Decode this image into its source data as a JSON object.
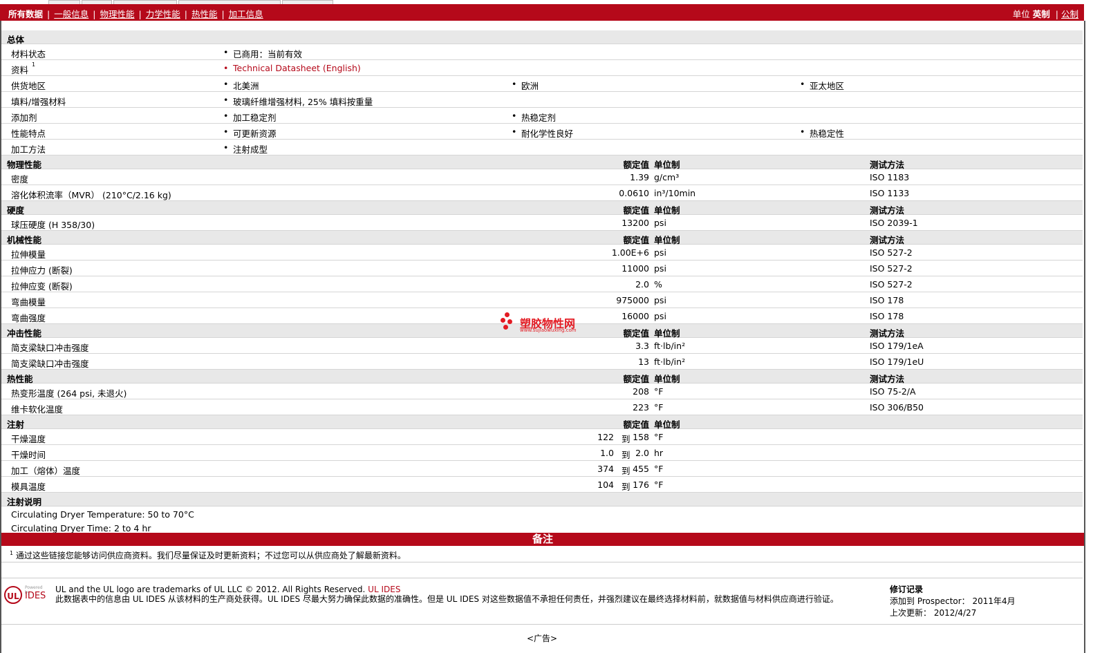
{
  "nav": {
    "all": "所有数据",
    "tabs": [
      "一般信息",
      "物理性能",
      "力学性能",
      "热性能",
      "加工信息"
    ],
    "sep": "|",
    "units_label": "单位",
    "units_current": "英制",
    "units_other": "公制"
  },
  "general": {
    "title": "总体",
    "rows": [
      {
        "label": "材料状态",
        "values": [
          "已商用：当前有效"
        ]
      },
      {
        "label": "资料",
        "sup": "1",
        "values": [
          "Technical Datasheet (English)"
        ]
      },
      {
        "label": "供货地区",
        "values": [
          "北美洲",
          "欧洲",
          "亚太地区"
        ]
      },
      {
        "label": "填料/增强材料",
        "values": [
          "玻璃纤维增强材料, 25% 填料按重量"
        ]
      },
      {
        "label": "添加剂",
        "values": [
          "加工稳定剂",
          "热稳定剂"
        ]
      },
      {
        "label": "性能特点",
        "values": [
          "可更新资源",
          "耐化学性良好",
          "热稳定性"
        ]
      },
      {
        "label": "加工方法",
        "values": [
          "注射成型"
        ]
      }
    ]
  },
  "col_headers": {
    "nominal": "额定值",
    "unit": "单位制",
    "method": "测试方法"
  },
  "sections": [
    {
      "title": "物理性能",
      "rows": [
        {
          "label": "密度",
          "value": "1.39",
          "unit": "g/cm³",
          "method": "ISO 1183"
        },
        {
          "label": "溶化体积流率（MVR） (210°C/2.16 kg)",
          "value": "0.0610",
          "unit": "in³/10min",
          "method": "ISO 1133"
        }
      ]
    },
    {
      "title": "硬度",
      "rows": [
        {
          "label": "球压硬度 (H 358/30)",
          "value": "13200",
          "unit": "psi",
          "method": "ISO 2039-1"
        }
      ]
    },
    {
      "title": "机械性能",
      "rows": [
        {
          "label": "拉伸模量",
          "value": "1.00E+6",
          "unit": "psi",
          "method": "ISO 527-2"
        },
        {
          "label": "拉伸应力 (断裂)",
          "value": "11000",
          "unit": "psi",
          "method": "ISO 527-2"
        },
        {
          "label": "拉伸应变 (断裂)",
          "value": "2.0",
          "unit": "%",
          "method": "ISO 527-2"
        },
        {
          "label": "弯曲模量",
          "value": "975000",
          "unit": "psi",
          "method": "ISO 178"
        },
        {
          "label": "弯曲强度",
          "value": "16000",
          "unit": "psi",
          "method": "ISO 178"
        }
      ]
    },
    {
      "title": "冲击性能",
      "rows": [
        {
          "label": "简支梁缺口冲击强度",
          "value": "3.3",
          "unit": "ft·lb/in²",
          "method": "ISO 179/1eA"
        },
        {
          "label": "简支梁缺口冲击强度",
          "value": "13",
          "unit": "ft·lb/in²",
          "method": "ISO 179/1eU"
        }
      ]
    },
    {
      "title": "热性能",
      "rows": [
        {
          "label": "热变形温度 (264 psi, 未退火)",
          "value": "208",
          "unit": "°F",
          "method": "ISO 75-2/A"
        },
        {
          "label": "维卡软化温度",
          "value": "223",
          "unit": "°F",
          "method": "ISO 306/B50"
        }
      ]
    }
  ],
  "injection": {
    "title": "注射",
    "to": "到",
    "rows": [
      {
        "label": "干燥温度",
        "lo": "122",
        "hi": "158",
        "unit": "°F"
      },
      {
        "label": "干燥时间",
        "lo": "1.0",
        "hi": "2.0",
        "unit": "hr"
      },
      {
        "label": "加工（熔体）温度",
        "lo": "374",
        "hi": "455",
        "unit": "°F"
      },
      {
        "label": "模具温度",
        "lo": "104",
        "hi": "176",
        "unit": "°F"
      }
    ]
  },
  "injection_notes": {
    "title": "注射说明",
    "lines": [
      "Circulating Dryer Temperature: 50 to 70°C",
      "Circulating Dryer Time: 2 to 4 hr"
    ]
  },
  "remarks": {
    "title": "备注",
    "sup": "1",
    "text": "通过这些链接您能够访问供应商资料。我们尽量保证及时更新资料；不过您可以从供应商处了解最新资料。"
  },
  "watermark": {
    "name": "塑胶物性网",
    "url": "www.sujiaowuxing.com"
  },
  "footer": {
    "logo_ul": "UL",
    "logo_ides": "IDES",
    "logo_powered": "Powered by",
    "legal1_prefix": "UL and the UL logo are trademarks of UL LLC © 2012. All Rights Reserved. ",
    "legal1_link": "UL IDES",
    "legal2": "此数据表中的信息由 UL IDES 从该材料的生产商处获得。UL IDES 尽最大努力确保此数据的准确性。但是 UL IDES 对这些数据值不承担任何责任，并强烈建议在最终选择材料前，就数据值与材料供应商进行验证。",
    "rev_title": "修订记录",
    "rev_added": "添加到 Prospector： 2011年4月",
    "rev_updated": "上次更新： 2012/4/27",
    "ad": "<广告>"
  },
  "colors": {
    "brand": "#b5091a",
    "header_bg": "#e8e8e8"
  }
}
